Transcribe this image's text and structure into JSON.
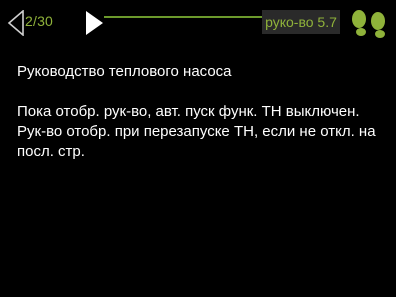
{
  "header": {
    "page_counter": "2/30",
    "section_badge": "руко-во 5.7",
    "back_icon": "triangle-left-outline-icon",
    "forward_icon": "triangle-right-filled-icon",
    "help_icon": "green-footsteps-icon"
  },
  "content": {
    "title": "Руководство теплового насоса",
    "paragraph_1": "Пока отобр. рук-во, авт. пуск функ. ТН выключен.",
    "paragraph_2": "Рук-во отобр. при перезапуске ТН, если не откл. на посл. стр."
  },
  "colors": {
    "background": "#000000",
    "accent_green": "#8fb23a",
    "line_green": "#6c9a2c",
    "badge_bg": "#2a2a2a",
    "text": "#ffffff"
  }
}
